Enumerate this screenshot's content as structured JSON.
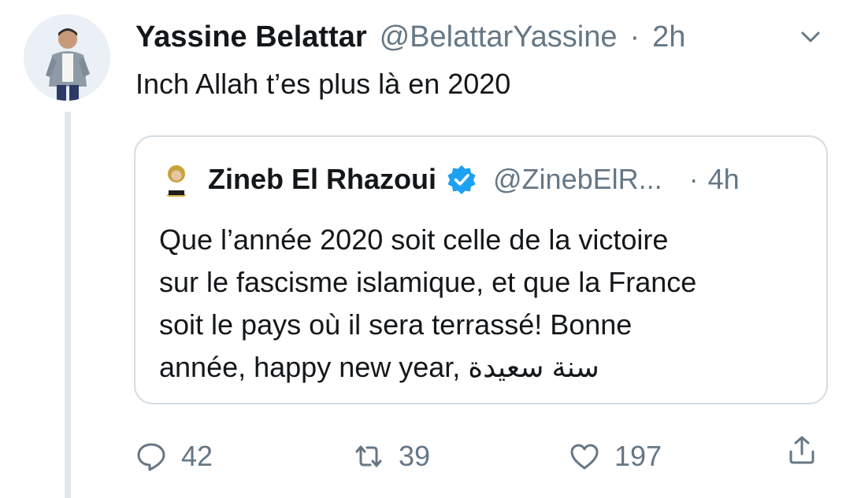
{
  "tweet": {
    "author_name": "Yassine Belattar",
    "author_handle": "@BelattarYassine",
    "separator": "·",
    "time": "2h",
    "text": "Inch Allah t’es plus là en 2020",
    "menu_icon": "chevron-down-icon"
  },
  "quoted_tweet": {
    "author_name": "Zineb El Rhazoui",
    "verified_icon": "verified-badge-icon",
    "author_handle": "@ZinebElR...",
    "separator": "·",
    "time": "4h",
    "text_lines": [
      "Que l’année 2020 soit celle de la victoire",
      "sur le fascisme islamique, et que la France",
      "soit le pays où il sera terrassé! Bonne",
      "année, happy new year, سنة سعيدة"
    ]
  },
  "actions": {
    "reply_count": "42",
    "retweet_count": "39",
    "like_count": "197",
    "icons": [
      "reply-icon",
      "retweet-icon",
      "like-icon",
      "share-icon"
    ]
  },
  "colors": {
    "text_primary": "#14171a",
    "text_secondary": "#657786",
    "verified_blue": "#1da1f2",
    "border": "#d5dde3"
  }
}
